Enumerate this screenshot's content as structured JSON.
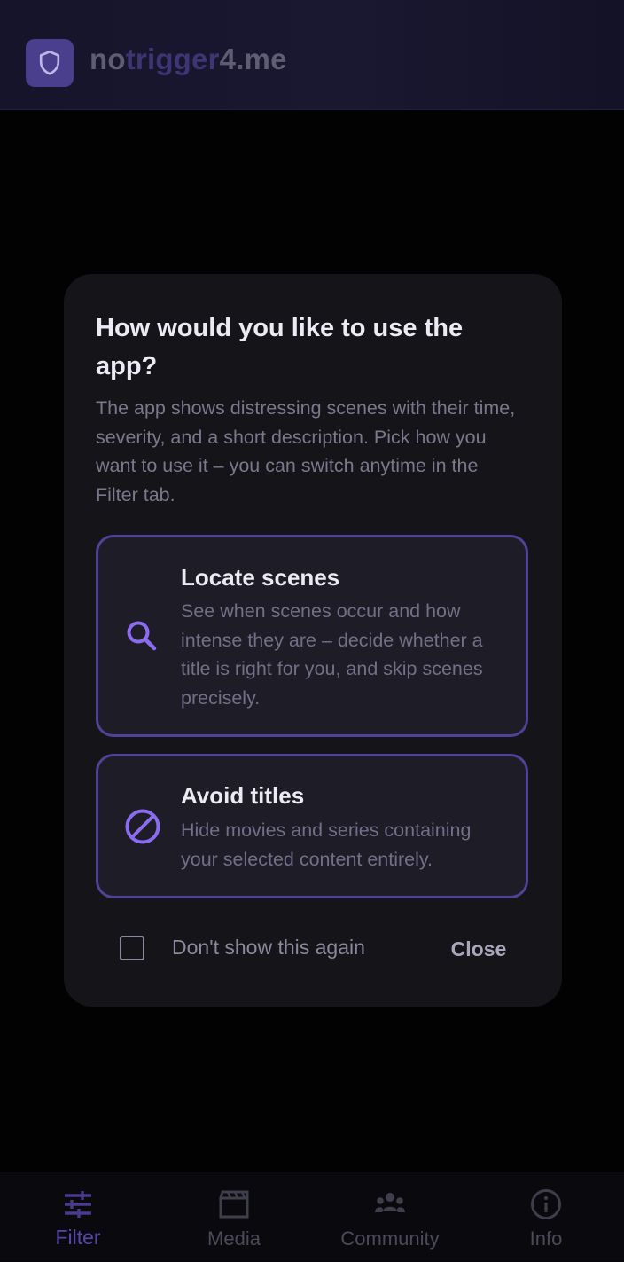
{
  "header": {
    "brand_part1": "no",
    "brand_part2": "trigger",
    "brand_part3": "4.me",
    "logo_icon": "shield-icon"
  },
  "dialog": {
    "title": "How would you like to use the app?",
    "description": "The app shows distressing scenes with their time, severity, and a short description. Pick how you want to use it – you can switch anytime in the Filter tab.",
    "options": [
      {
        "icon": "search-icon",
        "title": "Locate scenes",
        "description": "See when scenes occur and how intense they are – decide whether a title is right for you, and skip scenes precisely."
      },
      {
        "icon": "block-icon",
        "title": "Avoid titles",
        "description": "Hide movies and series containing your selected content entirely."
      }
    ],
    "checkbox_label": "Don't show this again",
    "checkbox_checked": false,
    "close_label": "Close"
  },
  "nav": {
    "items": [
      {
        "label": "Filter",
        "icon": "sliders-icon",
        "active": true
      },
      {
        "label": "Media",
        "icon": "clapperboard-icon",
        "active": false
      },
      {
        "label": "Community",
        "icon": "group-icon",
        "active": false
      },
      {
        "label": "Info",
        "icon": "info-icon",
        "active": false
      }
    ]
  },
  "colors": {
    "accent": "#8b6cf0",
    "option_border": "#4e4396",
    "dialog_bg": "#141419"
  }
}
